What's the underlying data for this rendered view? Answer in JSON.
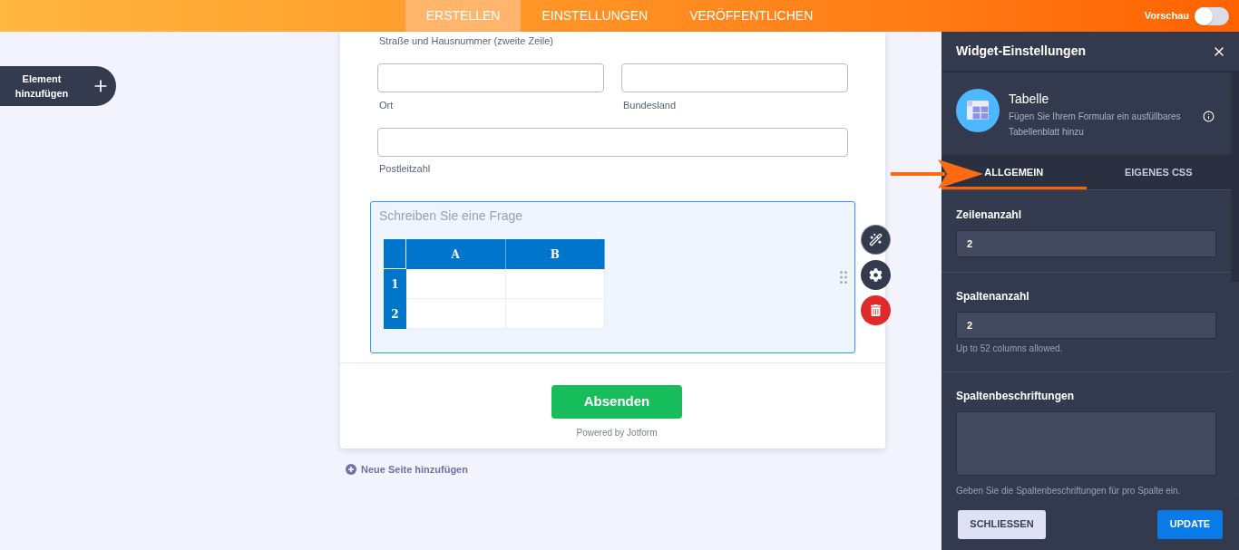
{
  "top_bar": {
    "tabs": [
      {
        "label": "ERSTELLEN",
        "selected": true
      },
      {
        "label": "EINSTELLUNGEN",
        "selected": false
      },
      {
        "label": "VERÖFFENTLICHEN",
        "selected": false
      }
    ],
    "preview": {
      "label": "Vorschau",
      "on": false
    }
  },
  "add_element_button": {
    "label": "Element hinzufügen"
  },
  "form": {
    "address": {
      "street_line2_label": "Straße und Hausnummer (zweite Zeile)",
      "rows": [
        [
          {
            "label": "Ort"
          },
          {
            "label": "Bundesland"
          }
        ],
        [
          {
            "label": "Postleitzahl"
          }
        ]
      ]
    },
    "question": {
      "placeholder": "Schreiben Sie eine Frage",
      "selected": true,
      "table": {
        "columns": [
          "A",
          "B"
        ],
        "rows": [
          "1",
          "2"
        ]
      }
    },
    "submit_button": {
      "label": "Absenden"
    },
    "footer": "Powered by Jotform"
  },
  "add_page_link": {
    "label": "Neue Seite hinzufügen"
  },
  "settings_panel": {
    "title": "Widget-Einstellungen",
    "widget": {
      "name": "Tabelle",
      "description": "Fügen Sie Ihrem Formular ein ausfüllbares Tabellenblatt hinzu"
    },
    "tabs": [
      {
        "label": "ALLGEMEIN",
        "selected": true
      },
      {
        "label": "EIGENES CSS",
        "selected": false
      }
    ],
    "settings": [
      {
        "kind": "number",
        "label": "Zeilenanzahl",
        "value": "2"
      },
      {
        "kind": "number",
        "label": "Spaltenanzahl",
        "value": "2",
        "hint": "Up to 52 columns allowed."
      },
      {
        "kind": "textarea",
        "label": "Spaltenbeschriftungen",
        "hint": "Geben Sie die Spaltenbeschriftungen für pro Spalte ein."
      }
    ],
    "buttons": [
      {
        "label": "SCHLIESSEN",
        "kind": "secondary"
      },
      {
        "label": "UPDATE",
        "kind": "primary"
      }
    ]
  }
}
